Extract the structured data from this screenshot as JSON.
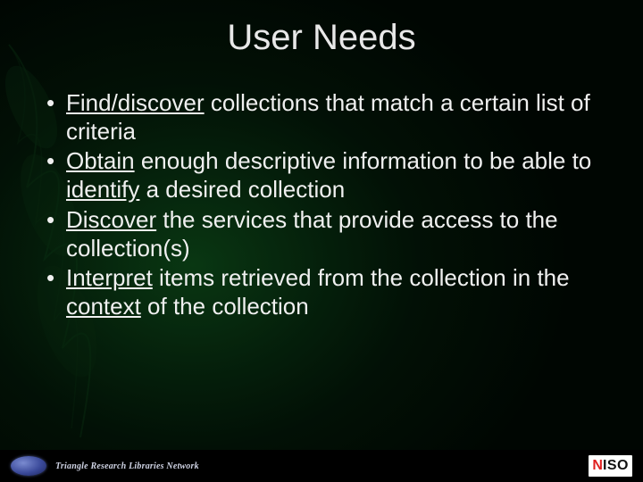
{
  "title": "User Needs",
  "bullets": [
    {
      "segments": [
        {
          "t": "Find/discover",
          "u": true
        },
        {
          "t": " collections that match a certain list of criteria",
          "u": false
        }
      ]
    },
    {
      "segments": [
        {
          "t": "Obtain",
          "u": true
        },
        {
          "t": " enough descriptive information to be able to ",
          "u": false
        },
        {
          "t": "identify",
          "u": true
        },
        {
          "t": " a desired collection",
          "u": false
        }
      ]
    },
    {
      "segments": [
        {
          "t": "Discover",
          "u": true
        },
        {
          "t": " the services that provide access to the collection(s)",
          "u": false
        }
      ]
    },
    {
      "segments": [
        {
          "t": "Interpret",
          "u": true
        },
        {
          "t": " items retrieved from the collection in the ",
          "u": false
        },
        {
          "t": "context",
          "u": true
        },
        {
          "t": " of the collection",
          "u": false
        }
      ]
    }
  ],
  "footer": {
    "trln": "Triangle Research Libraries Network",
    "niso_prefix": "N",
    "niso_suffix": "ISO"
  }
}
